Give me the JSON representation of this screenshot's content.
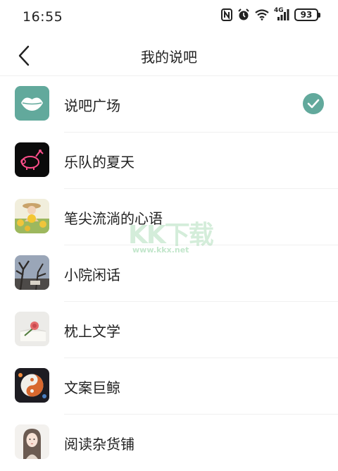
{
  "status_bar": {
    "time": "16:55",
    "network": "4G",
    "battery": "93",
    "icons": [
      "nfc-icon",
      "alarm-icon",
      "wifi-icon",
      "cellular-signal-icon",
      "battery-icon"
    ]
  },
  "nav": {
    "back_icon": "chevron-left-icon",
    "title": "我的说吧"
  },
  "list": {
    "items": [
      {
        "label": "说吧广场",
        "thumb": "lips-logo",
        "selected": true
      },
      {
        "label": "乐队的夏天",
        "thumb": "pig-neon-logo",
        "selected": false
      },
      {
        "label": "笔尖流淌的心语",
        "thumb": "girl-sunflowers-photo",
        "selected": false
      },
      {
        "label": "小院闲话",
        "thumb": "courtyard-tree-photo",
        "selected": false
      },
      {
        "label": "枕上文学",
        "thumb": "rose-book-photo",
        "selected": false
      },
      {
        "label": "文案巨鲸",
        "thumb": "yin-yang-art",
        "selected": false
      },
      {
        "label": "阅读杂货铺",
        "thumb": "girl-illustration",
        "selected": false
      }
    ]
  },
  "colors": {
    "accent": "#62a99c"
  },
  "watermark": {
    "big": "KK下载",
    "small": "www.kkx.net"
  }
}
